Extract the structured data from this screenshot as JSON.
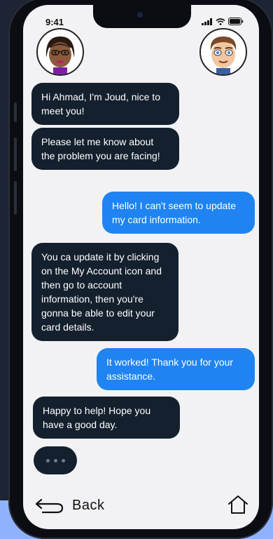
{
  "status_bar": {
    "time": "9:41"
  },
  "avatars": {
    "agent": {
      "name": "Joud"
    },
    "user": {
      "name": "Ahmad"
    }
  },
  "messages": [
    {
      "from": "agent",
      "text": "Hi Ahmad, I'm Joud, nice to meet you!"
    },
    {
      "from": "agent",
      "text": "Please let me know about the problem you are facing!"
    },
    {
      "from": "user",
      "text": "Hello! I can't seem to update my card information."
    },
    {
      "from": "agent",
      "text": "You ca update it by clicking on the My Account icon and then go to account information, then you're gonna be able to edit your card details."
    },
    {
      "from": "user",
      "text": "It worked! Thank you for your assistance."
    },
    {
      "from": "agent",
      "text": "Happy to help! Hope you have a good day."
    }
  ],
  "bottom_nav": {
    "back_label": "Back"
  },
  "colors": {
    "agent_bubble": "#14202e",
    "user_bubble": "#1f84f2",
    "screen_bg": "#f2f2f4"
  }
}
